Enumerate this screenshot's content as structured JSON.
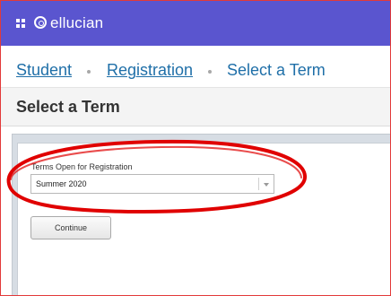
{
  "header": {
    "brand": "ellucian",
    "grid_icon": "grid-icon",
    "logo_icon": "ellucian-logo-icon",
    "bar_color": "#5a55cf"
  },
  "breadcrumb": {
    "student": "Student",
    "registration": "Registration",
    "current": "Select a Term",
    "link_color": "#1f6fa8"
  },
  "page": {
    "title": "Select a Term"
  },
  "form": {
    "terms_label": "Terms Open for Registration",
    "terms_selected": "Summer 2020",
    "continue_label": "Continue"
  },
  "annotation": {
    "color": "#e00000"
  }
}
